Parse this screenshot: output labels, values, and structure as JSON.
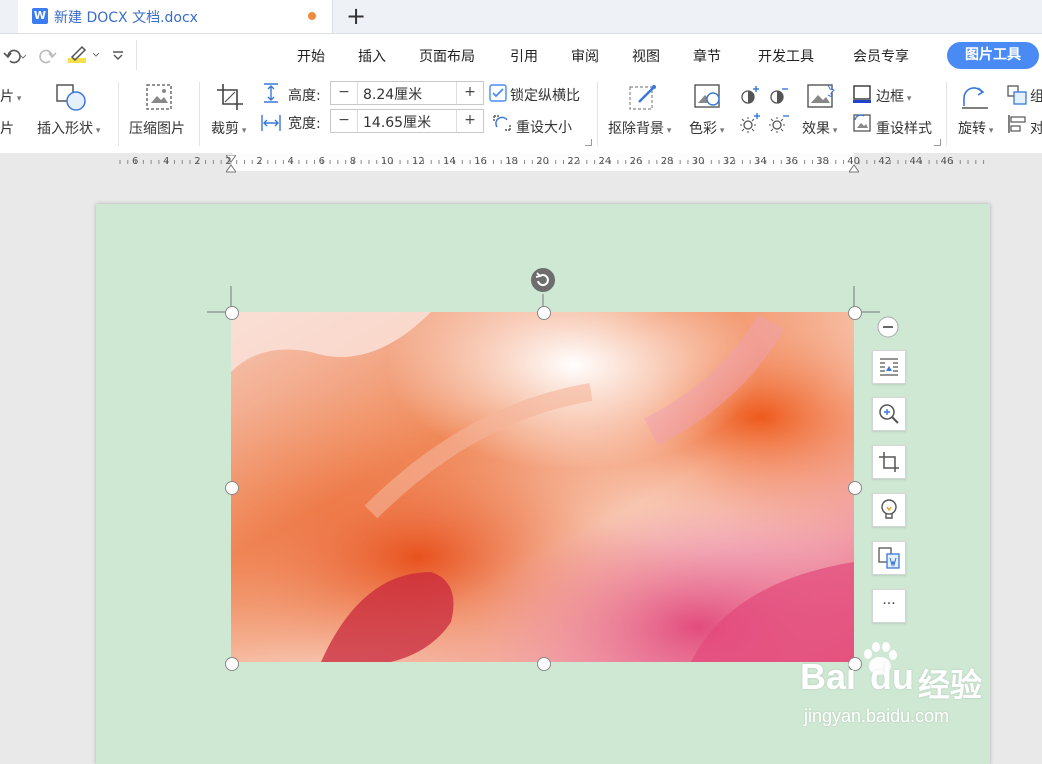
{
  "tab": {
    "title": "新建 DOCX 文档.docx",
    "new_tab": "+"
  },
  "menu": [
    "开始",
    "插入",
    "页面布局",
    "引用",
    "审阅",
    "视图",
    "章节",
    "开发工具",
    "会员专享"
  ],
  "active_tab": "图片工具",
  "ribbon": {
    "picture_partial_top": "片",
    "picture_partial_bottom": "片",
    "insert_shape": "插入形状",
    "compress_picture": "压缩图片",
    "crop": "裁剪",
    "height_label": "高度:",
    "height_value": "8.24厘米",
    "width_label": "宽度:",
    "width_value": "14.65厘米",
    "lock_ratio": "锁定纵横比",
    "reset_size": "重设大小",
    "remove_background": "抠除背景",
    "color": "色彩",
    "effects": "效果",
    "border": "边框",
    "reset_style": "重设样式",
    "rotate": "旋转",
    "group_partial": "组",
    "align_partial": "对",
    "spin_minus": "−",
    "spin_plus": "+"
  },
  "ruler": {
    "labels": [
      "6",
      "4",
      "2",
      "2",
      "2",
      "4",
      "6",
      "8",
      "10",
      "12",
      "14",
      "16",
      "18",
      "20",
      "22",
      "24",
      "26",
      "28",
      "30",
      "32",
      "34",
      "36",
      "38",
      "40",
      "42",
      "44",
      "46"
    ]
  },
  "float_toolbar": {
    "more": "···"
  },
  "watermark": {
    "brand": "Bai",
    "brand2": "du",
    "site_cn": "经验",
    "url": "jingyan.baidu.com"
  },
  "colors": {
    "accent": "#4a8af4",
    "page_bg": "#cfe8d4",
    "tab_title": "#3a6cc9"
  }
}
